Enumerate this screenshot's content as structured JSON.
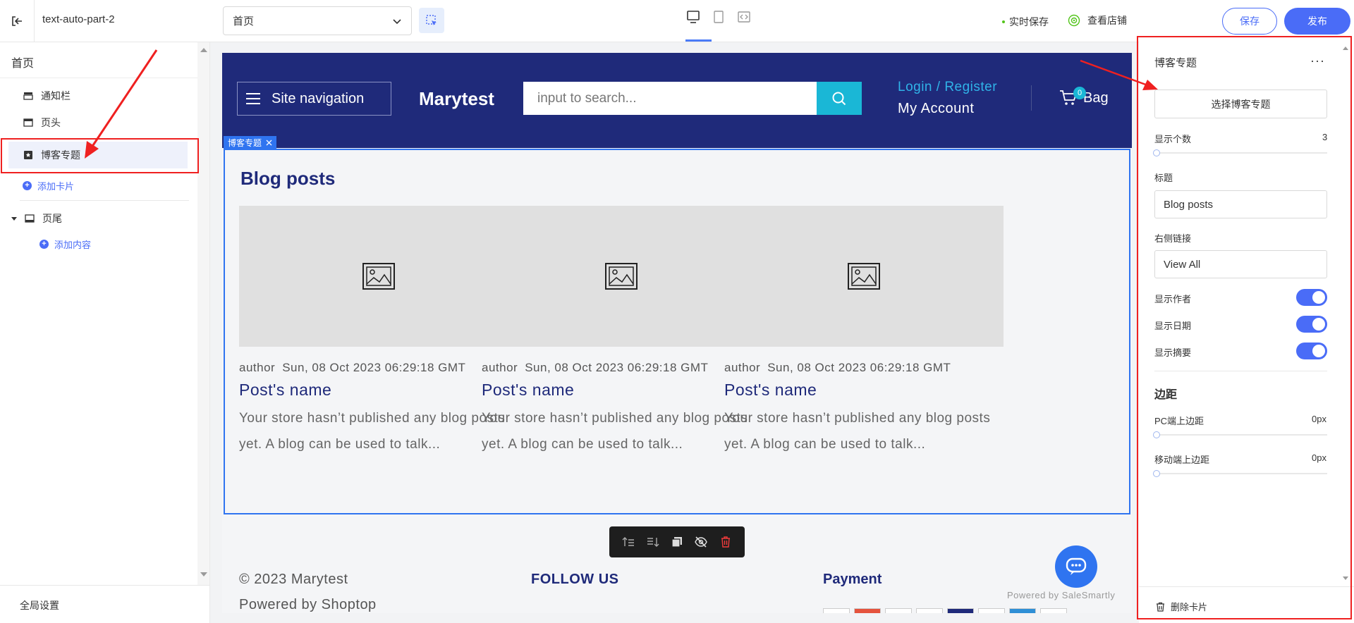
{
  "app": {
    "title": "text-auto-part-2",
    "page_select": {
      "value": "首页"
    },
    "autosave_label": "实时保存",
    "view_store_label": "查看店铺",
    "save_label": "保存",
    "publish_label": "发布"
  },
  "sidebar": {
    "heading": "首页",
    "items": [
      {
        "label": "通知栏",
        "icon": "announcement-bar-icon"
      },
      {
        "label": "页头",
        "icon": "header-icon"
      },
      {
        "label": "博客专题",
        "icon": "blog-icon",
        "selected": true
      }
    ],
    "add_card_label": "添加卡片",
    "footer_group": {
      "label": "页尾",
      "icon": "footer-icon"
    },
    "add_content_label": "添加内容",
    "global_settings_label": "全局设置"
  },
  "preview": {
    "header": {
      "nav_label": "Site navigation",
      "logo": "Marytest",
      "search_placeholder": "input to search...",
      "login_label": "Login / Register",
      "account_label": "My Account",
      "bag_label": "Bag",
      "bag_count": "0"
    },
    "section_tag": "博客专题",
    "blog": {
      "title": "Blog posts",
      "posts": [
        {
          "author": "author",
          "date": "Sun, 08 Oct 2023 06:29:18 GMT",
          "name": "Post's name",
          "excerpt": "Your store hasn’t published any blog posts yet. A blog can be used to talk..."
        },
        {
          "author": "author",
          "date": "Sun, 08 Oct 2023 06:29:18 GMT",
          "name": "Post's name",
          "excerpt": "Your store hasn’t published any blog posts yet. A blog can be used to talk..."
        },
        {
          "author": "author",
          "date": "Sun, 08 Oct 2023 06:29:18 GMT",
          "name": "Post's name",
          "excerpt": "Your store hasn’t published any blog posts yet. A blog can be used to talk..."
        }
      ]
    },
    "footer": {
      "copyright": "© 2023 Marytest",
      "powered": "Powered by Shoptop",
      "follow_title": "FOLLOW US",
      "payment_title": "Payment",
      "chat_powered": "Powered by SaleSmartly"
    }
  },
  "panel": {
    "title": "博客专题",
    "select_button": "选择博客专题",
    "count_label": "显示个数",
    "count_value": "3",
    "title_label": "标题",
    "title_value": "Blog posts",
    "link_label": "右侧链接",
    "link_value": "View All",
    "show_author_label": "显示作者",
    "show_date_label": "显示日期",
    "show_excerpt_label": "显示摘要",
    "show_author": true,
    "show_date": true,
    "show_excerpt": true,
    "spacing_title": "边距",
    "pc_top_label": "PC端上边距",
    "pc_top_value": "0px",
    "mobile_top_label": "移动端上边距",
    "mobile_top_value": "0px",
    "delete_label": "删除卡片"
  },
  "colors": {
    "accent": "#4a6cf7",
    "store_header": "#1f2a7a",
    "search_button": "#1ab7d6",
    "selection": "#2f74f0",
    "annotation": "#ef2020"
  }
}
